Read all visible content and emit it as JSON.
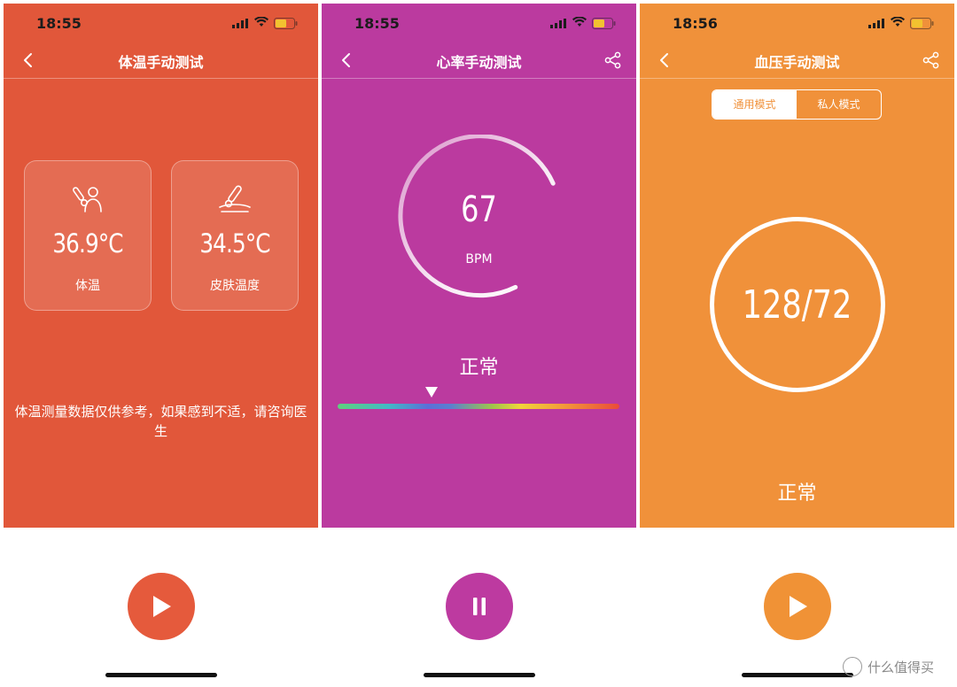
{
  "screens": {
    "temperature": {
      "time": "18:55",
      "title": "体温手动测试",
      "cards": [
        {
          "value": "36.9°C",
          "label": "体温",
          "icon": "body-temperature-icon"
        },
        {
          "value": "34.5°C",
          "label": "皮肤温度",
          "icon": "skin-temperature-icon"
        }
      ],
      "note": "体温测量数据仅供参考，如果感到不适，请咨询医生",
      "control": "play"
    },
    "heart_rate": {
      "time": "18:55",
      "title": "心率手动测试",
      "value": "67",
      "unit": "BPM",
      "status": "正常",
      "control": "pause"
    },
    "blood_pressure": {
      "time": "18:56",
      "title": "血压手动测试",
      "tabs": [
        "通用模式",
        "私人模式"
      ],
      "selected_tab": "通用模式",
      "value": "128/72",
      "status": "正常",
      "control": "play"
    }
  },
  "colors": {
    "temperature_bg": "#e1573a",
    "heart_bg": "#bb3a9f",
    "bp_bg": "#f0913a"
  },
  "watermark": {
    "text": "什么值得买",
    "icon": "smzdm-logo-icon"
  }
}
